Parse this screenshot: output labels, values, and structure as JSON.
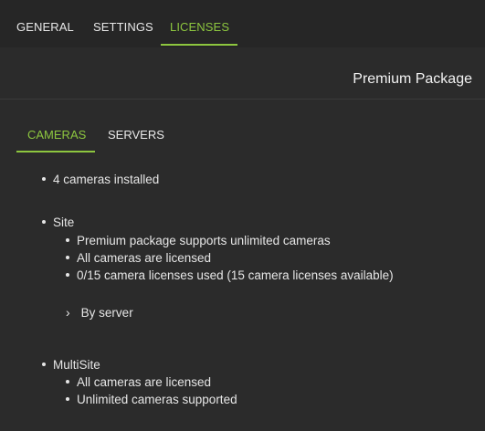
{
  "tabs": [
    {
      "label": "GENERAL"
    },
    {
      "label": "SETTINGS"
    },
    {
      "label": "LICENSES"
    }
  ],
  "package": {
    "title": "Premium Package"
  },
  "subtabs": [
    {
      "label": "CAMERAS"
    },
    {
      "label": "SERVERS"
    }
  ],
  "cameras": {
    "installed": "4 cameras installed",
    "site": {
      "label": "Site",
      "items": [
        "Premium package supports unlimited cameras",
        "All cameras are licensed",
        "0/15 camera licenses used (15 camera licenses available)"
      ],
      "by_server": "By server"
    },
    "multisite": {
      "label": "MultiSite",
      "items": [
        "All cameras are licensed",
        "Unlimited cameras supported"
      ]
    }
  },
  "colors": {
    "accent": "#8dc63f",
    "background": "#2b2b2b",
    "topbar": "#262626"
  },
  "icons": {
    "expander": "chevron-right-icon",
    "chevron_glyph": "›"
  }
}
